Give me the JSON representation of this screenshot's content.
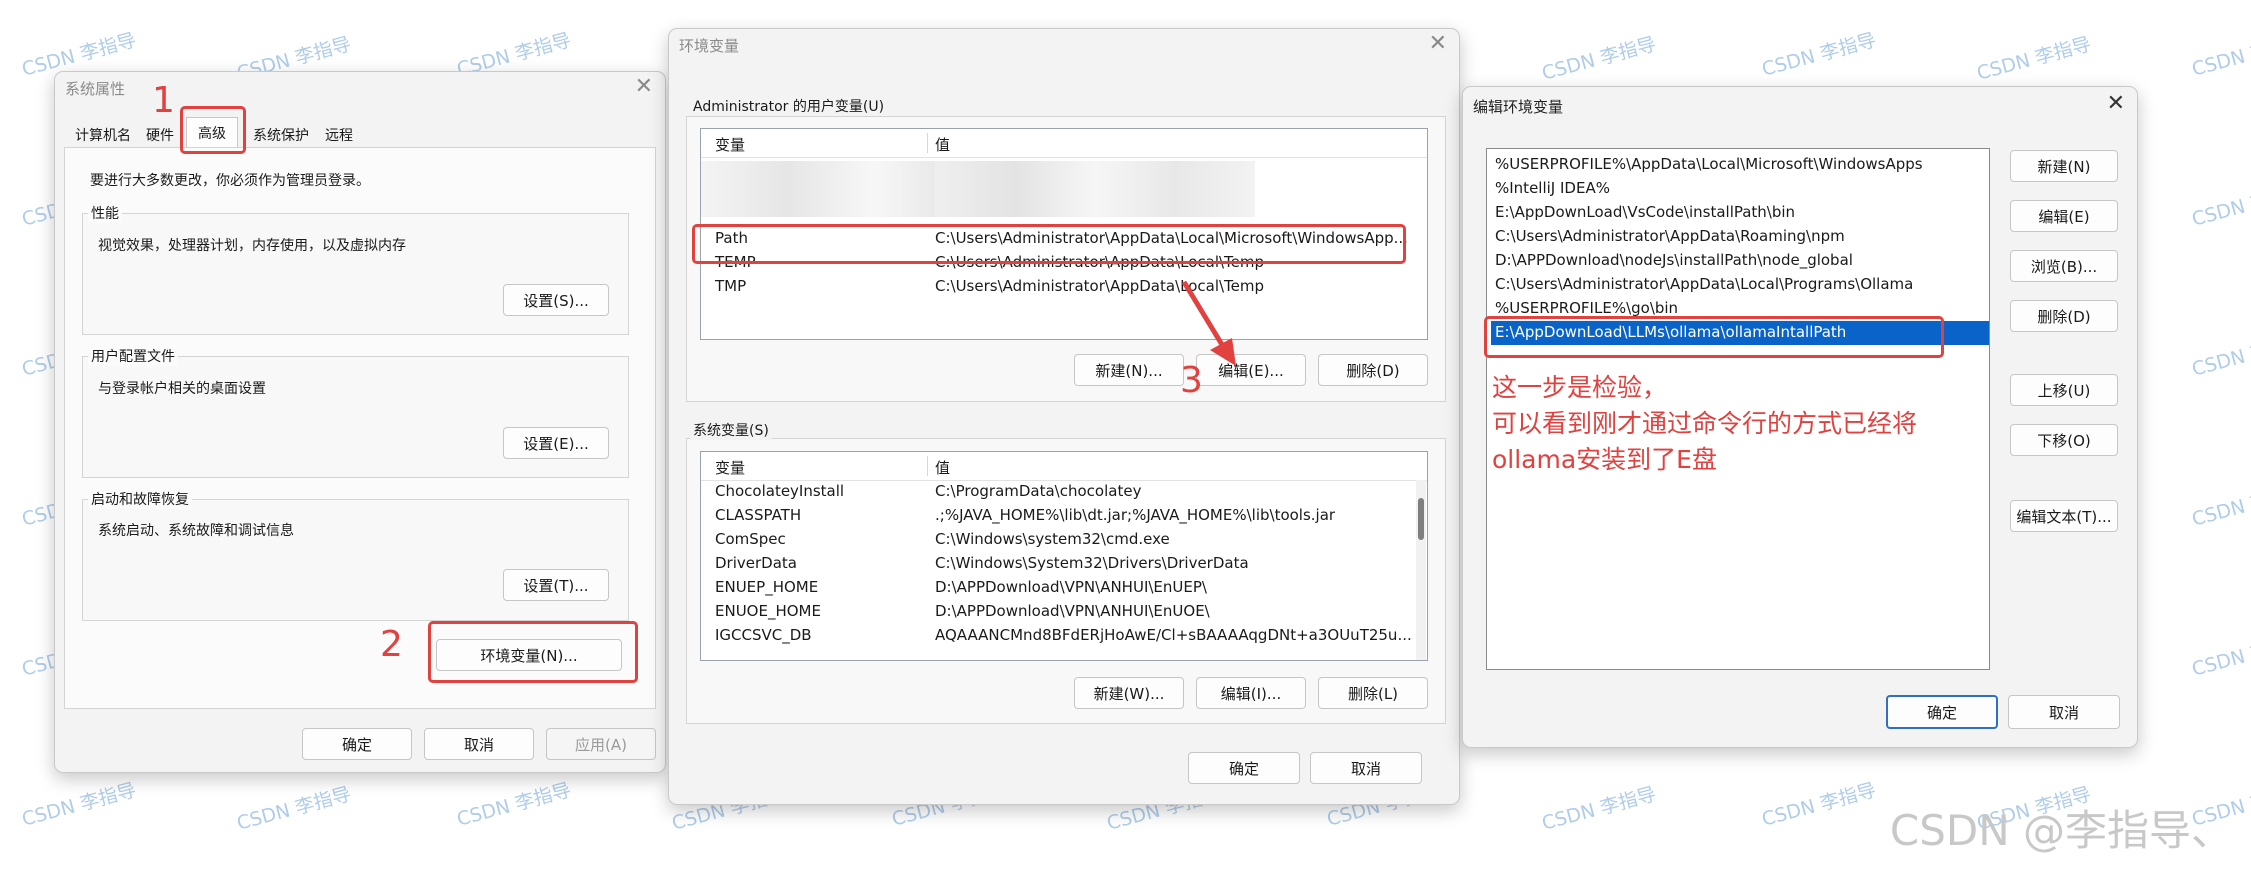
{
  "watermark": "CSDN 李指导",
  "corner_watermark": "CSDN @李指导、",
  "annotations": {
    "step1": "1",
    "step2": "2",
    "step3": "3",
    "note_lines": [
      "这一步是检验，",
      "可以看到刚才通过命令行的方式已经将",
      "ollama安装到了E盘"
    ],
    "color": "#e1413f"
  },
  "sysprops": {
    "title": "系统属性",
    "tabs": [
      "计算机名",
      "硬件",
      "高级",
      "系统保护",
      "远程"
    ],
    "active_tab": "高级",
    "admin_note": "要进行大多数更改，你必须作为管理员登录。",
    "performance": {
      "label": "性能",
      "desc": "视觉效果，处理器计划，内存使用，以及虚拟内存",
      "button": "设置(S)..."
    },
    "profile": {
      "label": "用户配置文件",
      "desc": "与登录帐户相关的桌面设置",
      "button": "设置(E)..."
    },
    "startup": {
      "label": "启动和故障恢复",
      "desc": "系统启动、系统故障和调试信息",
      "button": "设置(T)..."
    },
    "env_button": "环境变量(N)...",
    "ok": "确定",
    "cancel": "取消",
    "apply": "应用(A)"
  },
  "envvars": {
    "title": "环境变量",
    "user_group_label": "Administrator 的用户变量(U)",
    "col_var": "变量",
    "col_val": "值",
    "user_vars": [
      {
        "name": "Path",
        "value": "C:\\Users\\Administrator\\AppData\\Local\\Microsoft\\WindowsApp..."
      },
      {
        "name": "TEMP",
        "value": "C:\\Users\\Administrator\\AppData\\Local\\Temp"
      },
      {
        "name": "TMP",
        "value": "C:\\Users\\Administrator\\AppData\\Local\\Temp"
      }
    ],
    "user_buttons": {
      "new": "新建(N)...",
      "edit": "编辑(E)...",
      "delete": "删除(D)"
    },
    "sys_group_label": "系统变量(S)",
    "sys_vars": [
      {
        "name": "ChocolateyInstall",
        "value": "C:\\ProgramData\\chocolatey"
      },
      {
        "name": "CLASSPATH",
        "value": ".;%JAVA_HOME%\\lib\\dt.jar;%JAVA_HOME%\\lib\\tools.jar"
      },
      {
        "name": "ComSpec",
        "value": "C:\\Windows\\system32\\cmd.exe"
      },
      {
        "name": "DriverData",
        "value": "C:\\Windows\\System32\\Drivers\\DriverData"
      },
      {
        "name": "ENUEP_HOME",
        "value": "D:\\APPDownload\\VPN\\ANHUI\\EnUEP\\"
      },
      {
        "name": "ENUOE_HOME",
        "value": "D:\\APPDownload\\VPN\\ANHUI\\EnUOE\\"
      },
      {
        "name": "IGCCSVC_DB",
        "value": "AQAAANCMnd8BFdERjHoAwE/Cl+sBAAAAqgDNt+a3OUuT25u..."
      }
    ],
    "sys_buttons": {
      "new": "新建(W)...",
      "edit": "编辑(I)...",
      "delete": "删除(L)"
    },
    "ok": "确定",
    "cancel": "取消"
  },
  "editenv": {
    "title": "编辑环境变量",
    "entries": [
      "%USERPROFILE%\\AppData\\Local\\Microsoft\\WindowsApps",
      "%IntelliJ IDEA%",
      "E:\\AppDownLoad\\VsCode\\installPath\\bin",
      "C:\\Users\\Administrator\\AppData\\Roaming\\npm",
      "D:\\APPDownload\\nodeJs\\installPath\\node_global",
      "C:\\Users\\Administrator\\AppData\\Local\\Programs\\Ollama",
      "%USERPROFILE%\\go\\bin",
      "E:\\AppDownLoad\\LLMs\\ollama\\ollamaIntallPath"
    ],
    "selected_index": 7,
    "buttons": {
      "new": "新建(N)",
      "edit": "编辑(E)",
      "browse": "浏览(B)...",
      "delete": "删除(D)",
      "up": "上移(U)",
      "down": "下移(O)",
      "edit_text": "编辑文本(T)..."
    },
    "ok": "确定",
    "cancel": "取消",
    "accent": "#0a63c9"
  }
}
